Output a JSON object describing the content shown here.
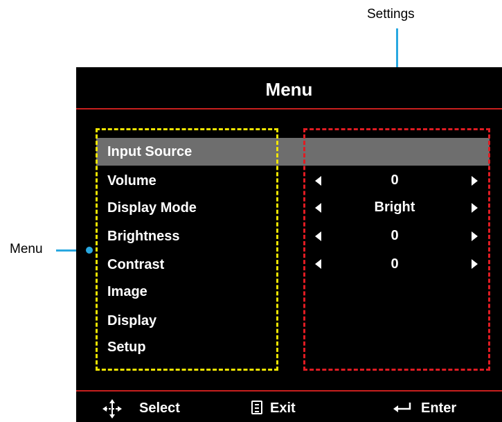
{
  "callouts": {
    "settings": "Settings",
    "menu": "Menu"
  },
  "osd": {
    "title": "Menu",
    "menu_items": [
      "Input Source",
      "Volume",
      "Display Mode",
      "Brightness",
      "Contrast",
      "Image",
      "Display",
      "Setup"
    ],
    "selected_item": "Input Source",
    "settings": {
      "volume": "0",
      "display_mode": "Bright",
      "brightness": "0",
      "contrast": "0"
    },
    "footer": {
      "select": "Select",
      "exit": "Exit",
      "enter": "Enter"
    },
    "icons": [
      "move-arrows-icon",
      "menu-list-icon",
      "enter-return-icon",
      "arrow-left-icon",
      "arrow-right-icon"
    ]
  },
  "colors": {
    "background": "#000000",
    "divider": "#c8201e",
    "menu_frame": "#f2e600",
    "settings_frame": "#e01b22",
    "highlight": "#6e6e6e",
    "callout": "#29a8e0"
  }
}
